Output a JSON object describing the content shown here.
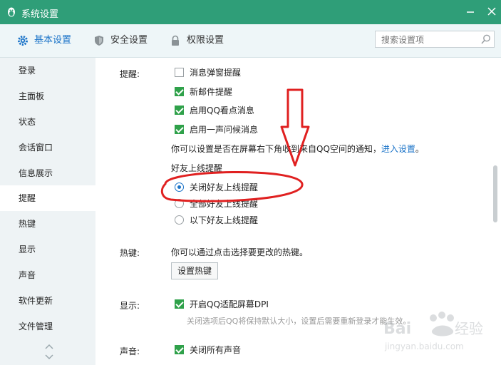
{
  "window": {
    "title": "系统设置"
  },
  "tabs": [
    {
      "label": "基本设置",
      "icon": "gear-icon",
      "active": true
    },
    {
      "label": "安全设置",
      "icon": "shield-icon",
      "active": false
    },
    {
      "label": "权限设置",
      "icon": "lock-icon",
      "active": false
    }
  ],
  "search": {
    "placeholder": "搜索设置项"
  },
  "sidebar": {
    "items": [
      {
        "label": "登录"
      },
      {
        "label": "主面板"
      },
      {
        "label": "状态"
      },
      {
        "label": "会话窗口"
      },
      {
        "label": "信息展示"
      },
      {
        "label": "提醒",
        "active": true
      },
      {
        "label": "热键"
      },
      {
        "label": "显示"
      },
      {
        "label": "声音"
      },
      {
        "label": "软件更新"
      },
      {
        "label": "文件管理"
      }
    ]
  },
  "remind": {
    "label": "提醒:",
    "options": [
      {
        "label": "消息弹窗提醒",
        "checked": false
      },
      {
        "label": "新邮件提醒",
        "checked": true
      },
      {
        "label": "启用QQ看点消息",
        "checked": true
      },
      {
        "label": "启用一声问候消息",
        "checked": true
      }
    ],
    "note": "你可以设置是否在屏幕右下角收到来自QQ空间的通知，",
    "note_link": "进入设置",
    "note_end": "。",
    "friend_online": {
      "title": "好友上线提醒",
      "options": [
        {
          "label": "关闭好友上线提醒",
          "selected": true
        },
        {
          "label": "全部好友上线提醒",
          "selected": false
        },
        {
          "label": "以下好友上线提醒",
          "selected": false
        }
      ]
    }
  },
  "hotkey": {
    "label": "热键:",
    "desc": "你可以通过点击选择要更改的热键。",
    "button": "设置热键"
  },
  "display": {
    "label": "显示:",
    "option": "开启QQ适配屏幕DPI",
    "checked": true,
    "hint": "关闭选项后QQ将保持默认大小，设置后需要重新登录才能生效。"
  },
  "sound": {
    "label": "声音:",
    "option": "关闭所有声音",
    "checked": true
  },
  "watermark": {
    "brand": "Baidu经验",
    "url": "jingyan.baidu.com"
  },
  "colors": {
    "titlebar": "#2f9e78",
    "accent": "#1a73c8",
    "check": "#2fa14a",
    "annotation": "#e02020"
  }
}
